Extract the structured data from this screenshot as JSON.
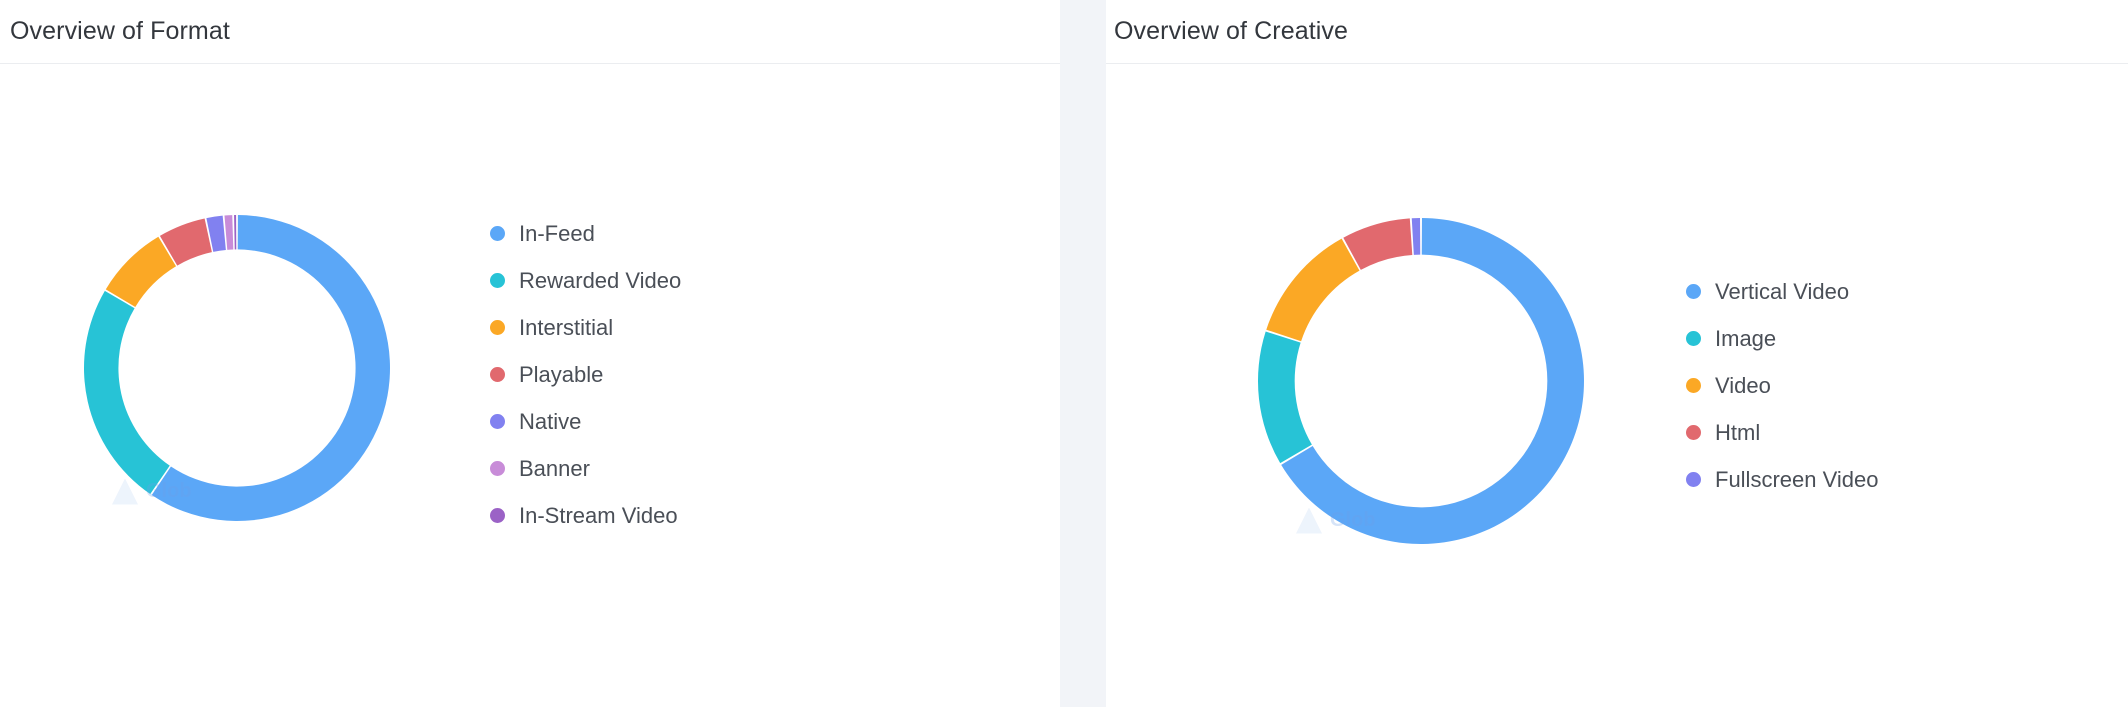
{
  "panels": [
    {
      "title": "Overview of Format",
      "watermark": "Glob"
    },
    {
      "title": "Overview of Creative",
      "watermark": "Glob"
    }
  ],
  "chart_data": [
    {
      "type": "pie",
      "title": "Overview of Format",
      "donut": true,
      "legend_position": "right",
      "categories": [
        "In-Feed",
        "Rewarded Video",
        "Interstitial",
        "Playable",
        "Native",
        "Banner",
        "In-Stream Video"
      ],
      "values": [
        59.5,
        24.0,
        8.0,
        5.2,
        1.9,
        1.0,
        0.4
      ],
      "colors": [
        "#5BA7F7",
        "#27C3D6",
        "#FBA825",
        "#E1696E",
        "#8181F0",
        "#C88CD8",
        "#9B62C6"
      ],
      "labels": [
        {
          "name": "In-Feed",
          "value": 59.5,
          "color": "#5BA7F7"
        },
        {
          "name": "Rewarded Video",
          "value": 24.0,
          "color": "#27C3D6"
        },
        {
          "name": "Interstitial",
          "value": 8.0,
          "color": "#FBA825"
        },
        {
          "name": "Playable",
          "value": 5.2,
          "color": "#E1696E"
        },
        {
          "name": "Native",
          "value": 1.9,
          "color": "#8181F0"
        },
        {
          "name": "Banner",
          "value": 1.0,
          "color": "#C88CD8"
        },
        {
          "name": "In-Stream Video",
          "value": 0.4,
          "color": "#9B62C6"
        }
      ]
    },
    {
      "type": "pie",
      "title": "Overview of Creative",
      "donut": true,
      "legend_position": "right",
      "categories": [
        "Vertical Video",
        "Image",
        "Video",
        "Html",
        "Fullscreen Video"
      ],
      "values": [
        66.5,
        13.5,
        12.0,
        7.0,
        1.0
      ],
      "colors": [
        "#5BA7F7",
        "#27C3D6",
        "#FBA825",
        "#E1696E",
        "#8181F0"
      ],
      "labels": [
        {
          "name": "Vertical Video",
          "value": 66.5,
          "color": "#5BA7F7"
        },
        {
          "name": "Image",
          "value": 13.5,
          "color": "#27C3D6"
        },
        {
          "name": "Video",
          "value": 12.0,
          "color": "#FBA825"
        },
        {
          "name": "Html",
          "value": 7.0,
          "color": "#E1696E"
        },
        {
          "name": "Fullscreen Video",
          "value": 1.0,
          "color": "#8181F0"
        }
      ]
    }
  ],
  "theme": {
    "background": "#f2f4f8",
    "panel_background": "#ffffff",
    "title_color": "#33373d",
    "legend_text_color": "#4a4f57",
    "divider_color": "#ebedf0"
  }
}
